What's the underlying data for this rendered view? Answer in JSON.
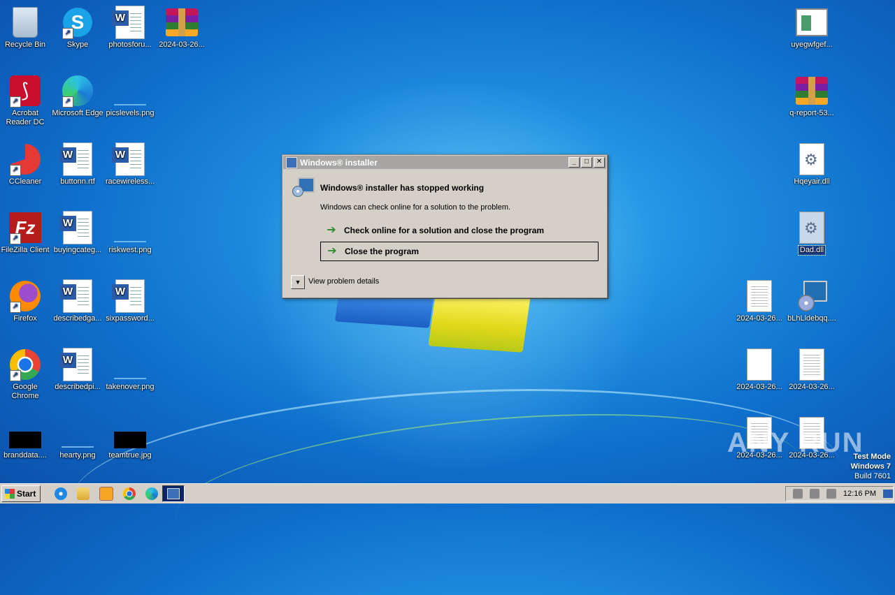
{
  "desktop": {
    "icons": [
      {
        "label": "Recycle Bin"
      },
      {
        "label": "Skype"
      },
      {
        "label": "photosforu..."
      },
      {
        "label": "2024-03-26..."
      },
      {
        "label": "Acrobat Reader DC"
      },
      {
        "label": "Microsoft Edge"
      },
      {
        "label": "picslevels.png"
      },
      {
        "label": "CCleaner"
      },
      {
        "label": "buttonn.rtf"
      },
      {
        "label": "racewireless..."
      },
      {
        "label": "FileZilla Client"
      },
      {
        "label": "buyingcateg..."
      },
      {
        "label": "riskwest.png"
      },
      {
        "label": "Firefox"
      },
      {
        "label": "describedga..."
      },
      {
        "label": "sixpassword..."
      },
      {
        "label": "Google Chrome"
      },
      {
        "label": "describedpi..."
      },
      {
        "label": "takenover.png"
      },
      {
        "label": "branddata...."
      },
      {
        "label": "hearty.png"
      },
      {
        "label": "teamtrue.jpg"
      },
      {
        "label": "uyegwfgef..."
      },
      {
        "label": "q-report-53..."
      },
      {
        "label": "Hqeyair.dll"
      },
      {
        "label": "Dad.dll"
      },
      {
        "label": "2024-03-26..."
      },
      {
        "label": "bLhLldebqq...."
      },
      {
        "label": "2024-03-26..."
      },
      {
        "label": "2024-03-26..."
      },
      {
        "label": "2024-03-26..."
      },
      {
        "label": "2024-03-26..."
      }
    ]
  },
  "dialog": {
    "title": "Windows® installer",
    "heading": "Windows® installer has stopped working",
    "subtext": "Windows can check online for a solution to the problem.",
    "option_check": "Check online for a solution and close the program",
    "option_close": "Close the program",
    "details": "View problem details",
    "btn_minimize": "_",
    "btn_maximize": "□",
    "btn_close": "✕"
  },
  "watermark": "ANY RUN",
  "testmode": {
    "line1": "Test Mode",
    "line2": "Windows 7",
    "line3": "Build 7601"
  },
  "taskbar": {
    "start_label": "Start",
    "clock": "12:16 PM"
  }
}
